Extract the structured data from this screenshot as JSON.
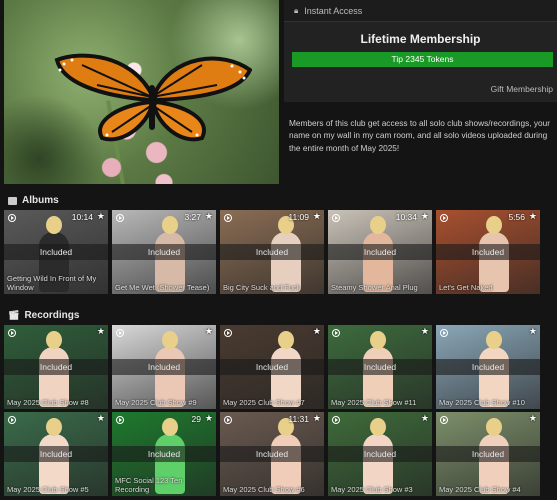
{
  "membership": {
    "header": "Instant Access",
    "title": "Lifetime Membership",
    "tip_button": "Tip 2345 Tokens",
    "gift_link": "Gift Membership",
    "description": "Members of this club get access to all solo club shows/recordings, your name on my wall in my cam room, and all solo videos uploaded during the entire month of May 2025!"
  },
  "sections": {
    "albums": "Albums",
    "recordings": "Recordings"
  },
  "albums": [
    {
      "duration": "10:14",
      "badge": "Included",
      "caption": "Getting Wild In Front of My Window",
      "bg": "#5a5a5a",
      "skin": "#2b2b2b"
    },
    {
      "duration": "3:27",
      "badge": "Included",
      "caption": "Get Me Wet (Shower Tease)",
      "bg": "#b8b8b8",
      "skin": "#d6b9a6"
    },
    {
      "duration": "11:09",
      "badge": "Included",
      "caption": "Big City Suck and Fuck",
      "bg": "#8a6d54",
      "skin": "#e7cfc0"
    },
    {
      "duration": "10:34",
      "badge": "Included",
      "caption": "Steamy Shower Anal Plug",
      "bg": "#c9c2b8",
      "skin": "#e2b79c"
    },
    {
      "duration": "5:56",
      "badge": "Included",
      "caption": "Let's Get Naked",
      "bg": "#a8502f",
      "skin": "#e7c4ad"
    }
  ],
  "recordings_row1": [
    {
      "duration": "",
      "badge": "Included",
      "caption": "May 2025 Club Show #8",
      "bg": "#2f5e3a",
      "skin": "#f0d3c0"
    },
    {
      "duration": "",
      "badge": "Included",
      "caption": "May 2025 Club Show #9",
      "bg": "#d8d8d8",
      "skin": "#ebc7b5"
    },
    {
      "duration": "",
      "badge": "Included",
      "caption": "May 2025 Club Show #7",
      "bg": "#4a3b30",
      "skin": "#f1d7c6"
    },
    {
      "duration": "",
      "badge": "Included",
      "caption": "May 2025 Club Show #11",
      "bg": "#3d6b3d",
      "skin": "#f0cfb9"
    },
    {
      "duration": "",
      "badge": "Included",
      "caption": "May 2025 Club Show #10",
      "bg": "#8aa7b8",
      "skin": "#f2d6c2"
    }
  ],
  "recordings_row2": [
    {
      "duration": "",
      "badge": "Included",
      "caption": "May 2025 Club Show #5",
      "bg": "#3a6b4a",
      "skin": "#f3d9c8"
    },
    {
      "duration": "29",
      "badge": "Included",
      "caption": "MFC Social 123 Ten Recording",
      "bg": "#1e7a2e",
      "skin": "#5fcf6a"
    },
    {
      "duration": "11:31",
      "badge": "Included",
      "caption": "May 2025 Club Show #6",
      "bg": "#6a5a50",
      "skin": "#efcdb9"
    },
    {
      "duration": "",
      "badge": "Included",
      "caption": "May 2025 Club Show #3",
      "bg": "#3e6b3a",
      "skin": "#f2d5c4"
    },
    {
      "duration": "",
      "badge": "Included",
      "caption": "May 2025 Club Show #4",
      "bg": "#7c8f6a",
      "skin": "#f0d0bd"
    }
  ]
}
